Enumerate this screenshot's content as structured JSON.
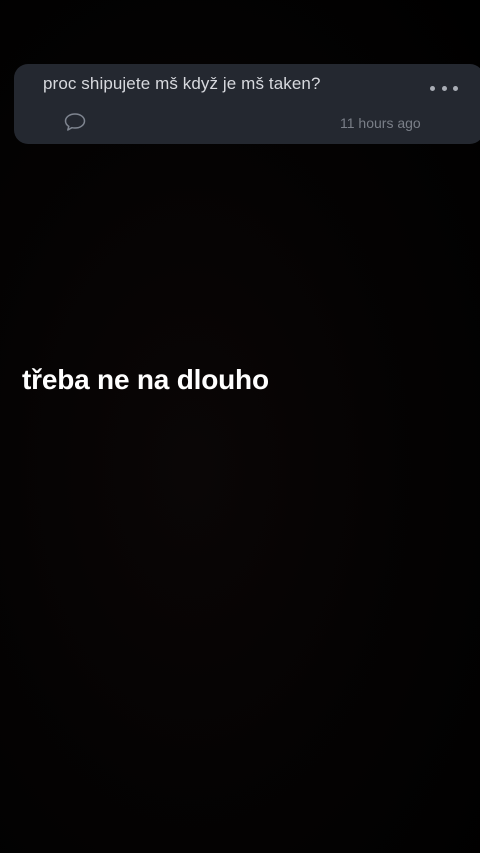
{
  "question_card": {
    "question": "proc shipujete mš když je mš taken?",
    "timestamp": "11 hours ago",
    "more_icon": "more-dots-icon",
    "comment_icon": "comment-bubble-icon"
  },
  "story": {
    "caption": "třeba ne na dlouho"
  },
  "colors": {
    "background": "#000000",
    "card": "#242830",
    "question_text": "#d7d9de",
    "meta_text": "#7a7f88",
    "caption_text": "#ffffff"
  }
}
